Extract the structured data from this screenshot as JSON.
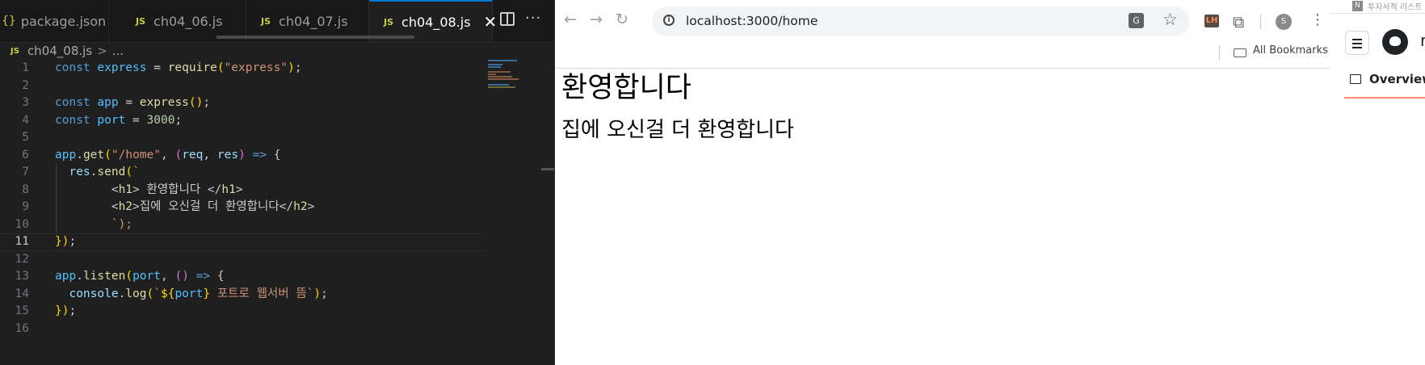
{
  "editor": {
    "tabs": [
      {
        "label": "package.json",
        "icon": "{}"
      },
      {
        "label": "ch04_06.js",
        "icon": "JS"
      },
      {
        "label": "ch04_07.js",
        "icon": "JS"
      },
      {
        "label": "ch04_08.js",
        "icon": "JS",
        "active": true
      }
    ],
    "close_glyph": "✕",
    "more_glyph": "···",
    "breadcrumb": {
      "icon": "JS",
      "file": "ch04_08.js",
      "sep": ">",
      "rest": "..."
    },
    "code_lines": [
      {
        "n": "1",
        "text": "const express = require(\"express\");"
      },
      {
        "n": "2",
        "text": ""
      },
      {
        "n": "3",
        "text": "const app = express();"
      },
      {
        "n": "4",
        "text": "const port = 3000;"
      },
      {
        "n": "5",
        "text": ""
      },
      {
        "n": "6",
        "text": "app.get(\"/home\", (req, res) => {"
      },
      {
        "n": "7",
        "text": "  res.send(`"
      },
      {
        "n": "8",
        "text": "        <h1> 환영합니다 </h1>"
      },
      {
        "n": "9",
        "text": "        <h2>집에 오신걸 더 환영합니다</h2>"
      },
      {
        "n": "10",
        "text": "        `);"
      },
      {
        "n": "11",
        "text": "});"
      },
      {
        "n": "12",
        "text": ""
      },
      {
        "n": "13",
        "text": "app.listen(port, () => {"
      },
      {
        "n": "14",
        "text": "  console.log(`${port} 포트로 웹서버 뜸`);"
      },
      {
        "n": "15",
        "text": "});"
      },
      {
        "n": "16",
        "text": ""
      }
    ],
    "current_line": "11",
    "colors": {
      "accent": "#0078d4",
      "background": "#1f1f1f"
    }
  },
  "browser": {
    "url": "localhost:3000/home",
    "nav": {
      "back": "←",
      "forward": "→",
      "reload": "↻"
    },
    "translate_icon": "G",
    "star_icon": "☆",
    "extension_badge": "LH",
    "puzzle_icon": "⧉",
    "profile_initial": "S",
    "menu_icon": "⋮",
    "bookmarks_label": "All Bookmarks",
    "page": {
      "h1": "환영합니다",
      "h2": "집에 오신걸 더 환영합니다"
    }
  },
  "right_window": {
    "tab_badge": "N",
    "tab_text": "투자서적 리스트",
    "user_initial": "r",
    "overview_label": "Overview",
    "colors": {
      "underline": "#fd8c73"
    }
  }
}
